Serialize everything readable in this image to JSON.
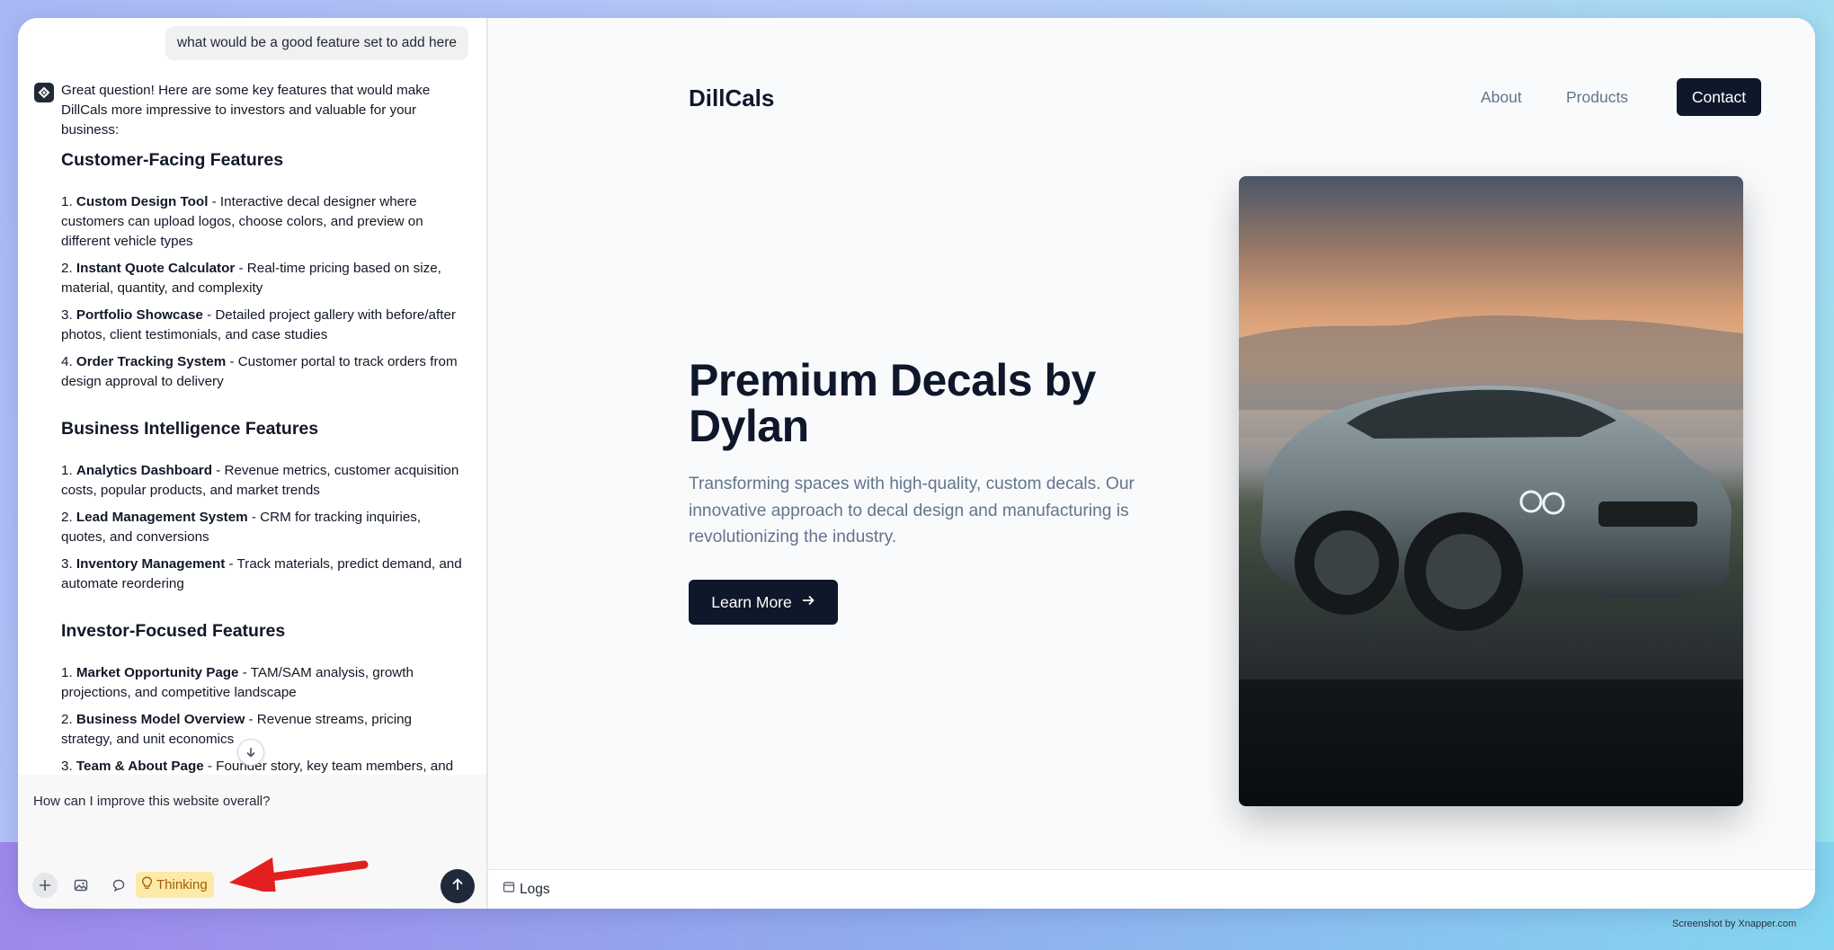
{
  "chat": {
    "user_message": "what would be a good feature set to add here",
    "reply_intro": "Great question! Here are some key features that would make DillCals more impressive to investors and valuable for your business:",
    "sections": [
      {
        "title": "Customer-Facing Features",
        "items": [
          {
            "num": "1.",
            "bold": "Custom Design Tool",
            "text": " - Interactive decal designer where customers can upload logos, choose colors, and preview on different vehicle types"
          },
          {
            "num": "2.",
            "bold": "Instant Quote Calculator",
            "text": " - Real-time pricing based on size, material, quantity, and complexity"
          },
          {
            "num": "3.",
            "bold": "Portfolio Showcase",
            "text": " - Detailed project gallery with before/after photos, client testimonials, and case studies"
          },
          {
            "num": "4.",
            "bold": "Order Tracking System",
            "text": " - Customer portal to track orders from design approval to delivery"
          }
        ]
      },
      {
        "title": "Business Intelligence Features",
        "items": [
          {
            "num": "1.",
            "bold": "Analytics Dashboard",
            "text": " - Revenue metrics, customer acquisition costs, popular products, and market trends"
          },
          {
            "num": "2.",
            "bold": "Lead Management System",
            "text": " - CRM for tracking inquiries, quotes, and conversions"
          },
          {
            "num": "3.",
            "bold": "Inventory Management",
            "text": " - Track materials, predict demand, and automate reordering"
          }
        ]
      },
      {
        "title": "Investor-Focused Features",
        "items": [
          {
            "num": "1.",
            "bold": "Market Opportunity Page",
            "text": " - TAM/SAM analysis, growth projections, and competitive landscape"
          },
          {
            "num": "2.",
            "bold": "Business Model Overview",
            "text": " - Revenue streams, pricing strategy, and unit economics"
          },
          {
            "num": "3.",
            "bold": "Team & About Page",
            "text": " - Founder story, key team members, and"
          }
        ]
      }
    ],
    "composer": {
      "value": "How can I improve this website overall?",
      "thinking_label": "Thinking"
    }
  },
  "preview": {
    "logo": "DillCals",
    "nav": {
      "about": "About",
      "products": "Products",
      "contact": "Contact"
    },
    "hero_title": "Premium Decals by Dylan",
    "hero_description": "Transforming spaces with high-quality, custom decals. Our innovative approach to decal design and manufacturing is revolutionizing the industry.",
    "cta_label": "Learn More",
    "logs_label": "Logs"
  },
  "watermark": "Screenshot by Xnapper.com",
  "colors": {
    "dark": "#0f172a",
    "muted": "#64748b",
    "thinking_bg": "#fde9a8",
    "thinking_text": "#a15c07",
    "annotation_arrow": "#e32020"
  },
  "icons": [
    "bot-logo-icon",
    "scroll-down-icon",
    "plus-icon",
    "image-icon",
    "chat-icon",
    "lightbulb-icon",
    "send-arrow-icon",
    "arrow-right-icon",
    "logs-icon"
  ]
}
